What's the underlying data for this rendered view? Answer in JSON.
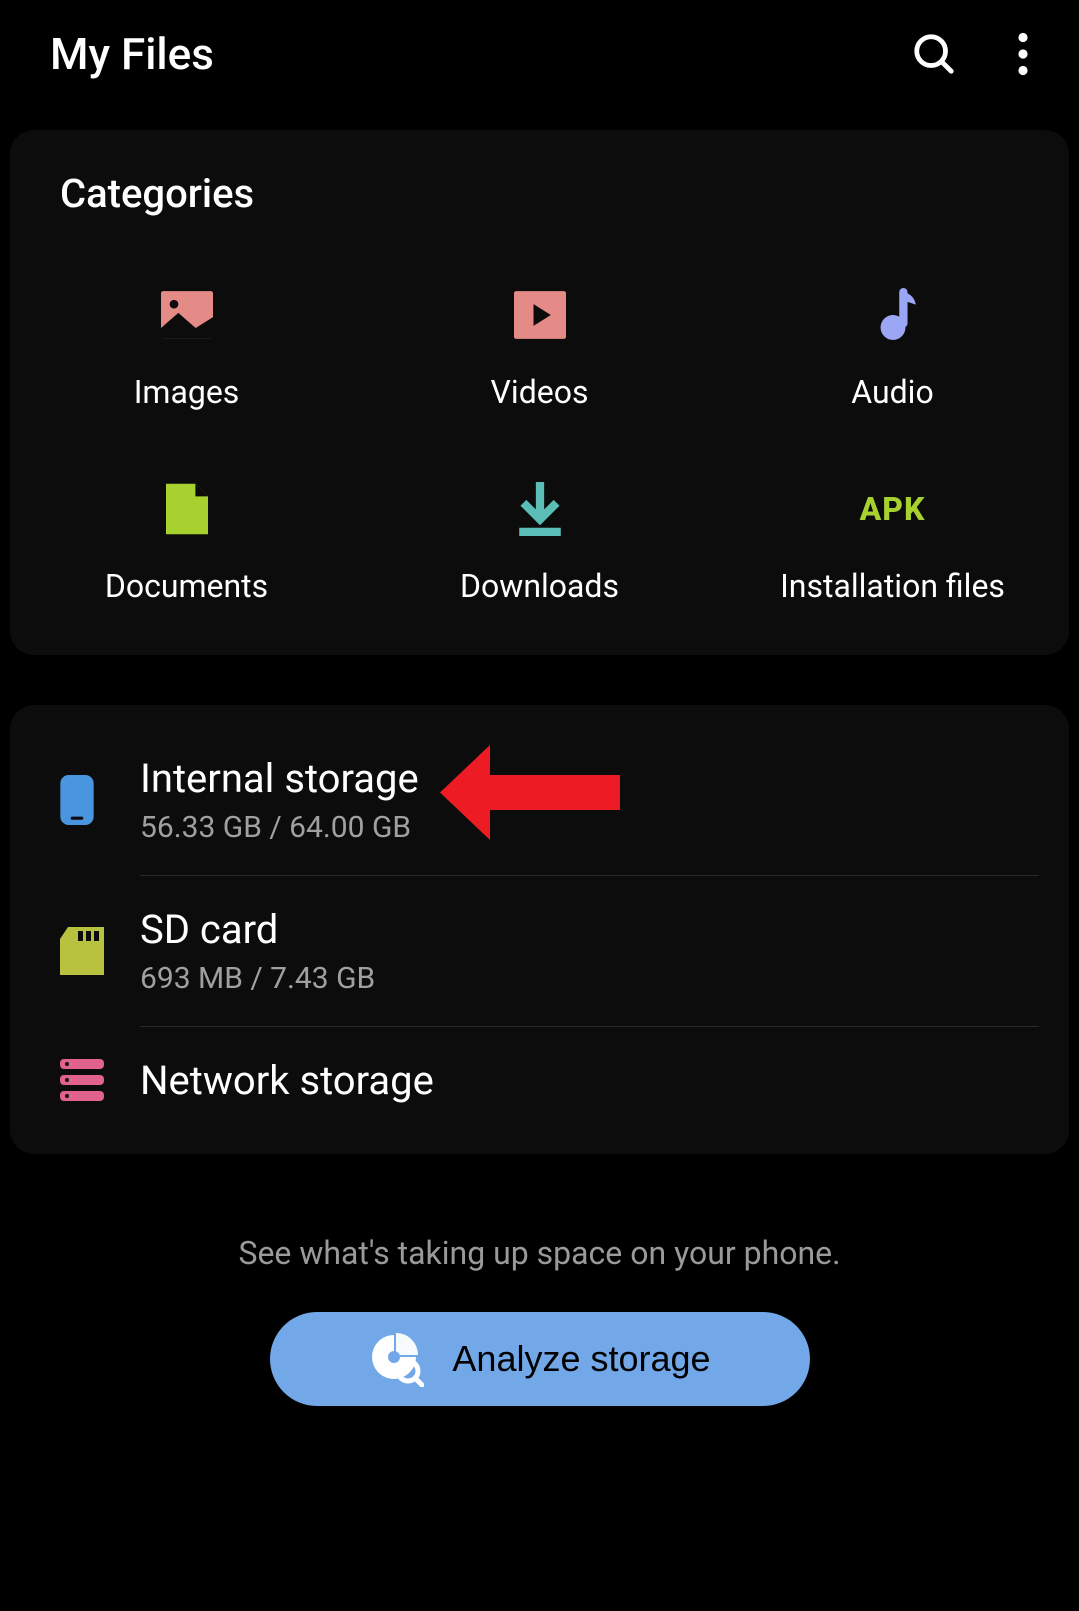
{
  "header": {
    "title": "My Files"
  },
  "categories": {
    "title": "Categories",
    "items": [
      {
        "label": "Images"
      },
      {
        "label": "Videos"
      },
      {
        "label": "Audio"
      },
      {
        "label": "Documents"
      },
      {
        "label": "Downloads"
      },
      {
        "label": "Installation files"
      }
    ]
  },
  "storage": {
    "items": [
      {
        "title": "Internal storage",
        "sub": "56.33 GB / 64.00 GB"
      },
      {
        "title": "SD card",
        "sub": "693 MB / 7.43 GB"
      },
      {
        "title": "Network storage",
        "sub": ""
      }
    ]
  },
  "footer": {
    "hint": "See what's taking up space on your phone.",
    "button": "Analyze storage"
  },
  "apk_label": "APK"
}
